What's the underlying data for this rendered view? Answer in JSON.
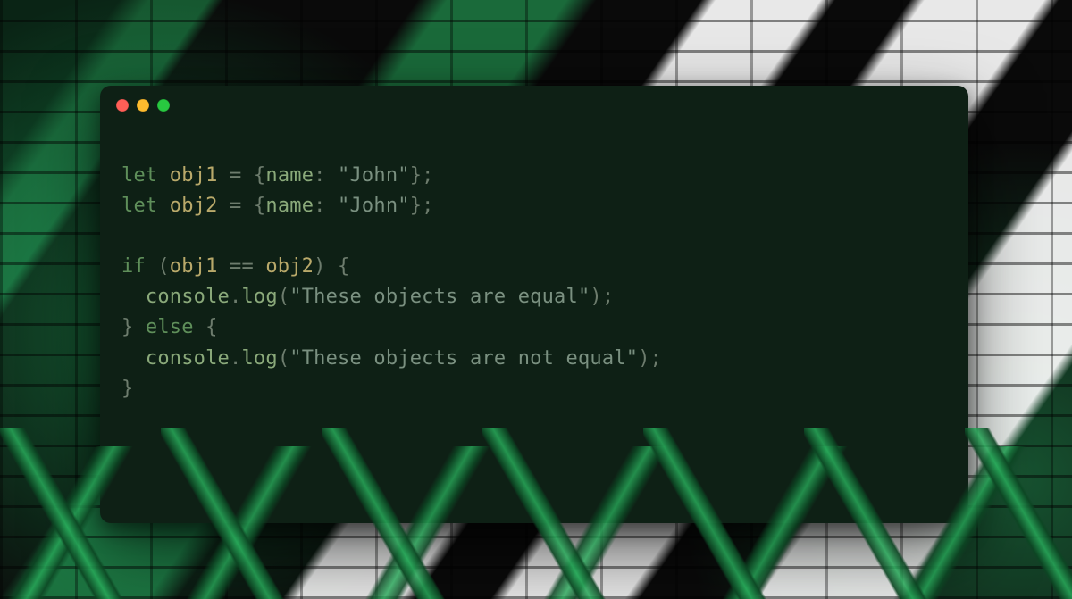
{
  "window": {
    "controls": {
      "close": "close",
      "minimize": "minimize",
      "zoom": "zoom"
    }
  },
  "code": {
    "kw_let1": "let",
    "var_obj1_a": "obj1",
    "op_eq1": " = ",
    "brace_o1": "{",
    "prop_name1": "name",
    "colon1": ": ",
    "str_john1": "\"John\"",
    "brace_c1": "}",
    "semi1": ";",
    "kw_let2": "let",
    "var_obj2_a": "obj2",
    "op_eq2": " = ",
    "brace_o2": "{",
    "prop_name2": "name",
    "colon2": ": ",
    "str_john2": "\"John\"",
    "brace_c2": "}",
    "semi2": ";",
    "kw_if": "if",
    "paren_o1": " (",
    "var_obj1_b": "obj1",
    "op_cmp": " == ",
    "var_obj2_b": "obj2",
    "paren_c1": ") ",
    "brace_o3": "{",
    "indent1": "  ",
    "obj_console1": "console",
    "dot1": ".",
    "fn_log1": "log",
    "paren_o2": "(",
    "str_equal": "\"These objects are equal\"",
    "paren_c2": ")",
    "semi3": ";",
    "brace_c3": "}",
    "kw_else": " else ",
    "brace_o4": "{",
    "indent2": "  ",
    "obj_console2": "console",
    "dot2": ".",
    "fn_log2": "log",
    "paren_o3": "(",
    "str_noteq": "\"These objects are not equal\"",
    "paren_c3": ")",
    "semi4": ";",
    "brace_c4": "}"
  }
}
